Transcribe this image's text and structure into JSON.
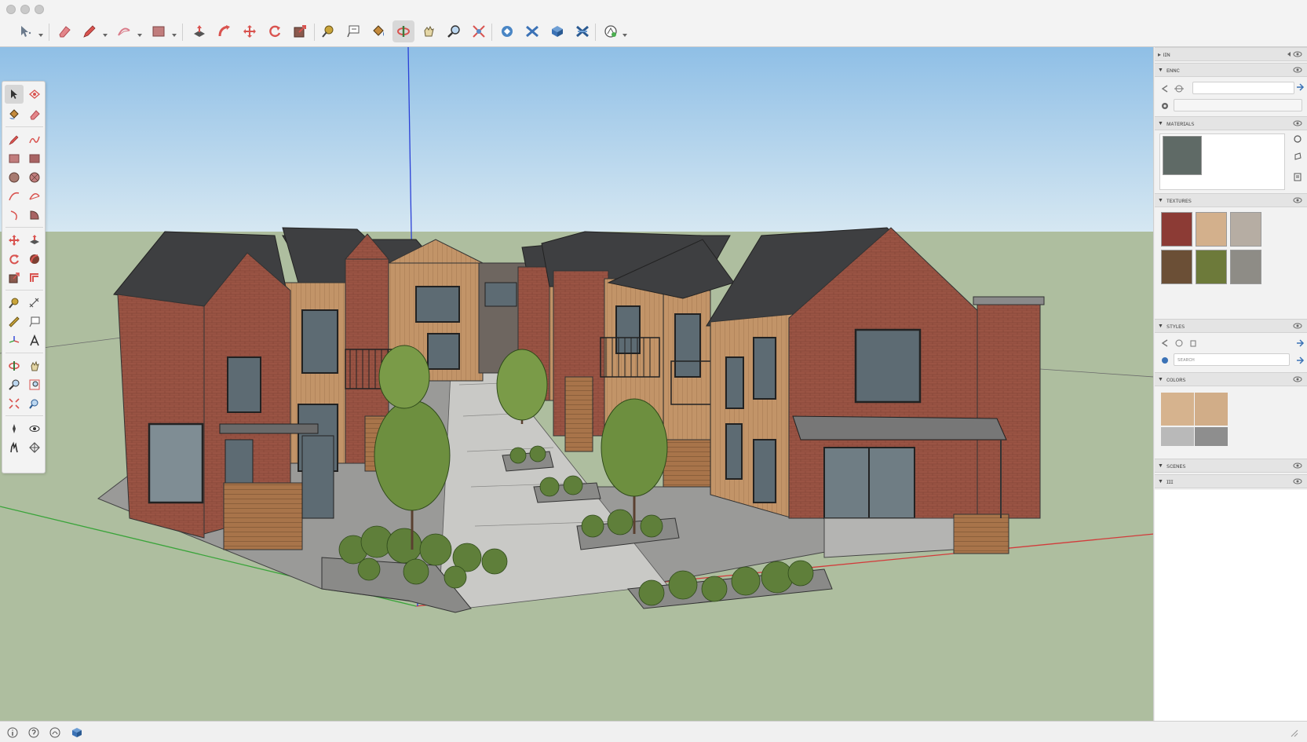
{
  "window": {
    "controls": [
      "close",
      "minimize",
      "zoom"
    ]
  },
  "toolbar": {
    "tools": [
      {
        "name": "select-tool",
        "icon": "select-arrow-icon"
      },
      {
        "name": "eraser-tool",
        "icon": "eraser-icon"
      },
      {
        "name": "pencil-tool",
        "icon": "pencil-icon"
      },
      {
        "name": "arc-tool",
        "icon": "arc-icon"
      },
      {
        "name": "rectangle-tool",
        "icon": "rectangle-icon"
      },
      {
        "name": "push-pull-tool",
        "icon": "push-pull-icon"
      },
      {
        "name": "follow-me-tool",
        "icon": "follow-me-icon"
      },
      {
        "name": "move-tool",
        "icon": "move-icon"
      },
      {
        "name": "rotate-tool",
        "icon": "rotate-icon"
      },
      {
        "name": "scale-tool",
        "icon": "scale-icon"
      },
      {
        "name": "tape-measure-tool",
        "icon": "tape-measure-icon"
      },
      {
        "name": "text-tool",
        "icon": "text-icon"
      },
      {
        "name": "paint-bucket-tool",
        "icon": "paint-bucket-icon"
      },
      {
        "name": "orbit-tool",
        "icon": "orbit-icon",
        "active": true
      },
      {
        "name": "pan-tool",
        "icon": "pan-icon"
      },
      {
        "name": "zoom-tool",
        "icon": "zoom-icon"
      },
      {
        "name": "zoom-extents-tool",
        "icon": "zoom-extents-icon"
      },
      {
        "name": "warehouse-tool",
        "icon": "warehouse-icon"
      },
      {
        "name": "extension-warehouse-tool",
        "icon": "extension-warehouse-icon"
      },
      {
        "name": "layout-tool",
        "icon": "layout-icon"
      },
      {
        "name": "extension-manager-tool",
        "icon": "extension-manager-icon"
      },
      {
        "name": "geolocation-tool",
        "icon": "geolocation-icon"
      }
    ]
  },
  "scene": {
    "sky_top": "#8fbfe6",
    "sky_bottom": "#d7e8f2",
    "ground": "#aebe9f",
    "axis_red": "#d23b3b",
    "axis_green": "#3aa43a",
    "axis_blue": "#2a3fd6",
    "brick": "#9a5444",
    "wood": "#c29468",
    "roof": "#3e3f41",
    "paving": "#c9c9c6"
  },
  "tray": {
    "panels": [
      {
        "key": "tray-title",
        "label": "▸ ıɪɴ"
      },
      {
        "key": "entity-info",
        "label": "ᴇɴɴᴄ"
      },
      {
        "key": "materials",
        "label": "ᴍᴀᴛᴇʀɪᴀʟꜱ"
      },
      {
        "key": "textures",
        "label": "ᴛᴇxᴛᴜʀᴇꜱ"
      },
      {
        "key": "styles",
        "label": "ꜱᴛʏʟᴇꜱ"
      },
      {
        "key": "colors",
        "label": "ᴄᴏʟᴏʀꜱ"
      },
      {
        "key": "scenes",
        "label": "ꜱᴄᴇɴᴇꜱ"
      },
      {
        "key": "layers",
        "label": "ɪɪɪ"
      }
    ],
    "styles_placeholder": "ꜱᴇᴀʀᴄʜ",
    "material_swatches": [
      "#8c3b35",
      "#d3b08c",
      "#b6ada3",
      "#6b4f36",
      "#6d7a3a",
      "#8e8c86"
    ],
    "color_swatches": [
      "#d6b38e",
      "#d1ad88",
      "#b9b9b9",
      "#8e8e8e"
    ],
    "preview_material": "#5f6a66"
  },
  "statusbar": {
    "icons": [
      "info-icon",
      "help-icon",
      "credit-icon",
      "model-icon"
    ]
  }
}
